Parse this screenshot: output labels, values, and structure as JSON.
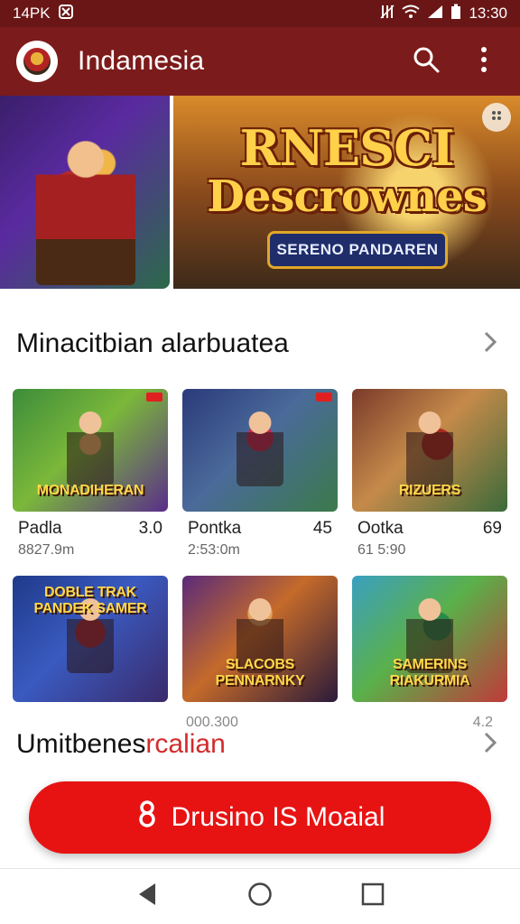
{
  "status_bar": {
    "left_text": "14PK",
    "time": "13:30",
    "icons": [
      "sim-icon",
      "no-signal-icon",
      "wifi-icon",
      "signal-icon",
      "battery-icon"
    ]
  },
  "app_bar": {
    "title": "Indamesia",
    "logo_icon": "app-logo-icon",
    "actions": [
      "search-icon",
      "more-vert-icon"
    ]
  },
  "banner": {
    "title_line1": "RNESCI",
    "title_line2": "Descrownes",
    "subtitle": "SERENO PANDAREN"
  },
  "section1": {
    "title": "Minacitbian alarbuatea",
    "arrow_icon": "chevron-right-icon"
  },
  "games": [
    {
      "name": "Padla",
      "rating": "3.0",
      "sub": "8827.9m",
      "thumb_label": "MONADIHERAN"
    },
    {
      "name": "Pontka",
      "rating": "45",
      "sub": "2:53:0m",
      "thumb_label": ""
    },
    {
      "name": "Ootka",
      "rating": "69",
      "sub": "61 5:90",
      "thumb_label": "RIZUERS"
    },
    {
      "name": "",
      "rating": "",
      "sub": "",
      "thumb_label": "DOBLE TRAK PANDEK SAMER"
    },
    {
      "name": "",
      "rating": "4.2",
      "sub": "000.300",
      "thumb_label": "SLACOBS PENNARNKY"
    },
    {
      "name": "",
      "rating": "",
      "sub": "",
      "thumb_label": "SAMERINS RIAKURMIA"
    }
  ],
  "section2": {
    "title_part1": "Umitbenes",
    "title_part2": "rcalian",
    "arrow_icon": "chevron-right-icon"
  },
  "cta": {
    "label": "Drusino IS Moaial",
    "icon": "download-icon"
  },
  "nav": [
    "back-icon",
    "home-icon",
    "recents-icon"
  ],
  "colors": {
    "status_bar": "#6a1616",
    "app_bar": "#7c1b1b",
    "cta": "#e71313",
    "accent_text": "#d22b2b"
  }
}
